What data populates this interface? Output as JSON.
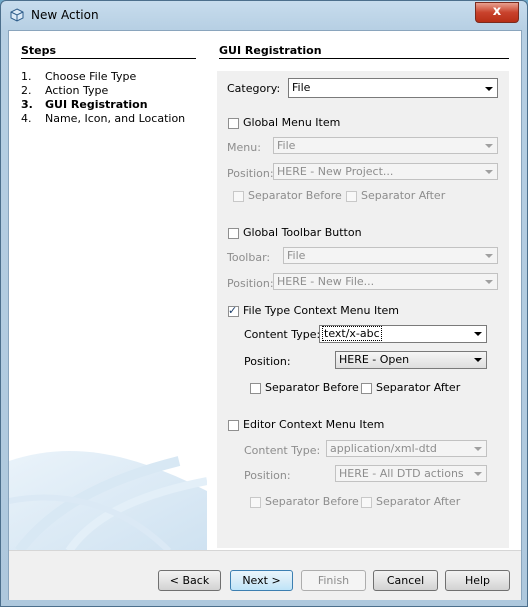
{
  "window": {
    "title": "New Action",
    "close_glyph": "x"
  },
  "steps": {
    "title": "Steps",
    "items": [
      {
        "num": "1.",
        "label": "Choose File Type"
      },
      {
        "num": "2.",
        "label": "Action Type"
      },
      {
        "num": "3.",
        "label": "GUI Registration"
      },
      {
        "num": "4.",
        "label": "Name, Icon, and Location"
      }
    ]
  },
  "panel": {
    "title": "GUI Registration",
    "category": {
      "label": "Category:",
      "value": "File"
    },
    "global_menu": {
      "label": "Global Menu Item",
      "checked": false,
      "menu_label": "Menu:",
      "menu_value": "File",
      "position_label": "Position:",
      "position_value": "HERE - New Project...",
      "sep_before": "Separator Before",
      "sep_after": "Separator After"
    },
    "global_toolbar": {
      "label": "Global Toolbar Button",
      "checked": false,
      "toolbar_label": "Toolbar:",
      "toolbar_value": "File",
      "position_label": "Position:",
      "position_value": "HERE - New File..."
    },
    "file_type_context": {
      "label": "File Type Context Menu Item",
      "checked": true,
      "content_type_label": "Content Type:",
      "content_type_value": "text/x-abc",
      "position_label": "Position:",
      "position_value": "HERE - Open",
      "sep_before": "Separator Before",
      "sep_after": "Separator After"
    },
    "editor_context": {
      "label": "Editor Context Menu Item",
      "checked": false,
      "content_type_label": "Content Type:",
      "content_type_value": "application/xml-dtd",
      "position_label": "Position:",
      "position_value": "HERE - All DTD actions",
      "sep_before": "Separator Before",
      "sep_after": "Separator After"
    }
  },
  "buttons": {
    "back": "< Back",
    "next": "Next >",
    "finish": "Finish",
    "cancel": "Cancel",
    "help": "Help"
  },
  "colors": {
    "accent": "#3c7fb1",
    "check": "#1b3d6a",
    "close": "#c9422c"
  }
}
